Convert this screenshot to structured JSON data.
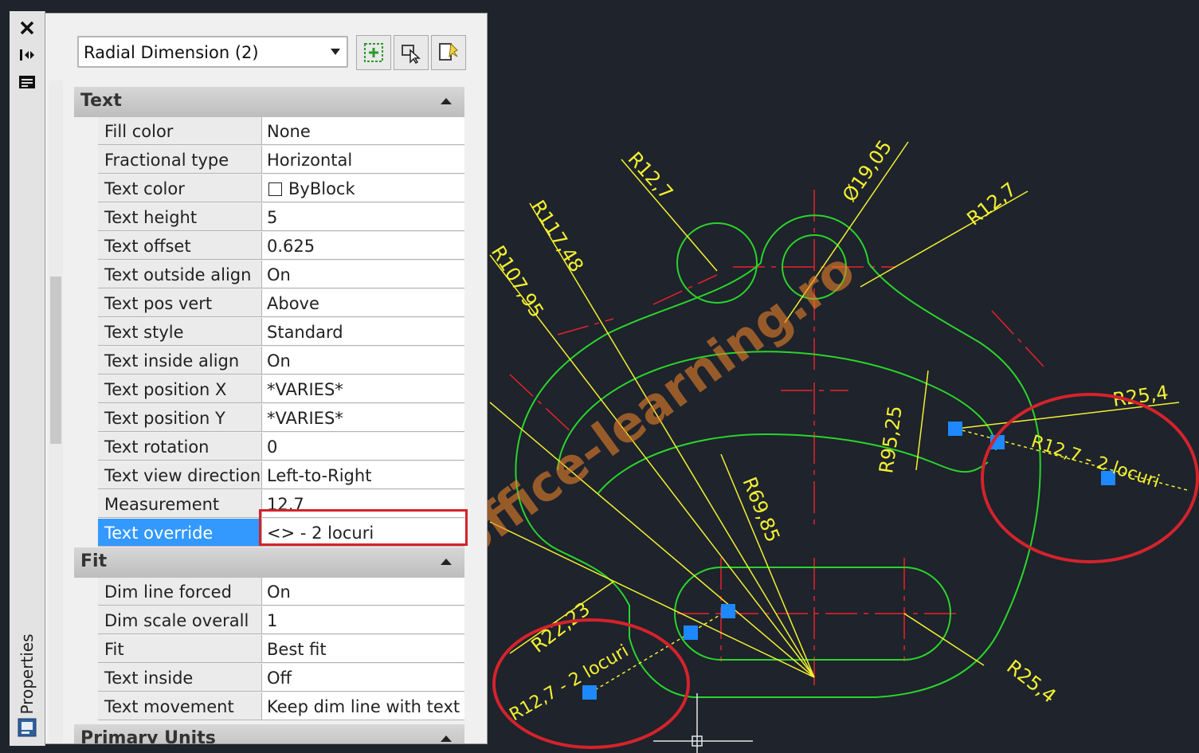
{
  "watermark": "www.office-learning.ro",
  "palette": {
    "title": "Properties",
    "object_type": "Radial Dimension (2)",
    "toolbar_icons": [
      "toggle-pickadd-icon",
      "select-objects-icon",
      "quick-select-icon"
    ],
    "sidebar_icons": [
      "close-icon",
      "autohide-icon",
      "properties-menu-icon",
      "palette-tab-icon"
    ],
    "sections": [
      {
        "title": "Text",
        "rows": [
          {
            "name": "Fill color",
            "value": "None"
          },
          {
            "name": "Fractional type",
            "value": "Horizontal"
          },
          {
            "name": "Text color",
            "value": "ByBlock",
            "swatch": "#ffffff"
          },
          {
            "name": "Text height",
            "value": "5"
          },
          {
            "name": "Text offset",
            "value": "0.625"
          },
          {
            "name": "Text outside align",
            "value": "On"
          },
          {
            "name": "Text pos vert",
            "value": "Above"
          },
          {
            "name": "Text style",
            "value": "Standard"
          },
          {
            "name": "Text inside align",
            "value": "On"
          },
          {
            "name": "Text position X",
            "value": "*VARIES*"
          },
          {
            "name": "Text position Y",
            "value": "*VARIES*"
          },
          {
            "name": "Text rotation",
            "value": "0"
          },
          {
            "name": "Text view direction",
            "value": "Left-to-Right"
          },
          {
            "name": "Measurement",
            "value": "12.7"
          },
          {
            "name": "Text override",
            "value": "<> - 2 locuri",
            "selected": true
          }
        ]
      },
      {
        "title": "Fit",
        "rows": [
          {
            "name": "Dim line forced",
            "value": "On"
          },
          {
            "name": "Dim scale overall",
            "value": "1"
          },
          {
            "name": "Fit",
            "value": "Best fit"
          },
          {
            "name": "Text inside",
            "value": "Off"
          },
          {
            "name": "Text movement",
            "value": "Keep dim line with text"
          }
        ]
      },
      {
        "title": "Primary Units",
        "rows": []
      }
    ]
  },
  "drawing": {
    "background": "#1e232c",
    "colors": {
      "geometry": "#2bd42b",
      "dimension": "#f3f031",
      "center": "#e8222b",
      "grip": "#1e88ff",
      "highlight": "#d4232b",
      "watermark": "#e8812a"
    },
    "dim_labels": [
      "R12,7",
      "Ø19,05",
      "R12,7",
      "R117,48",
      "R107,95",
      "R25,4",
      "R95,25",
      "R69,85",
      "R12,7 - 2 locuri",
      "R22,23",
      "R12,7 - 2 locuri",
      "R25,4"
    ]
  }
}
